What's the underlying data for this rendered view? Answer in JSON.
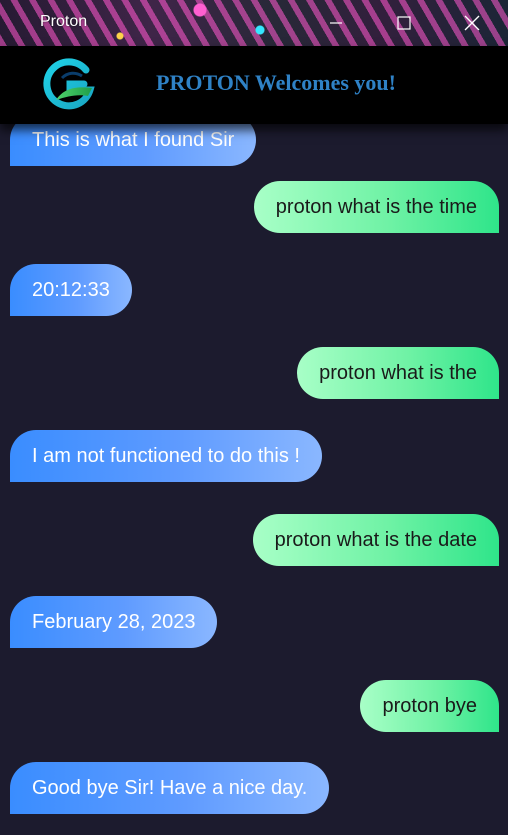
{
  "window": {
    "title": "Proton",
    "controls": [
      "minimize-icon",
      "maximize-icon",
      "close-icon"
    ]
  },
  "header": {
    "logo_icon": "proton-g-logo-icon",
    "welcome_text": "PROTON Welcomes you!",
    "welcome_color": "#2f82c6"
  },
  "colors": {
    "background": "#1c1b2e",
    "bot_bubble": "#3a8dff",
    "user_bubble": "#2fe58a"
  },
  "messages": [
    {
      "sender": "bot",
      "text": "This is what I found Sir"
    },
    {
      "sender": "user",
      "text": "proton what is the time"
    },
    {
      "sender": "bot",
      "text": "20:12:33"
    },
    {
      "sender": "user",
      "text": "proton what is the"
    },
    {
      "sender": "bot",
      "text": "I am not functioned to do this !"
    },
    {
      "sender": "user",
      "text": "proton what is the date"
    },
    {
      "sender": "bot",
      "text": "February 28, 2023"
    },
    {
      "sender": "user",
      "text": "proton bye"
    },
    {
      "sender": "bot",
      "text": "Good bye Sir! Have a nice day."
    }
  ]
}
